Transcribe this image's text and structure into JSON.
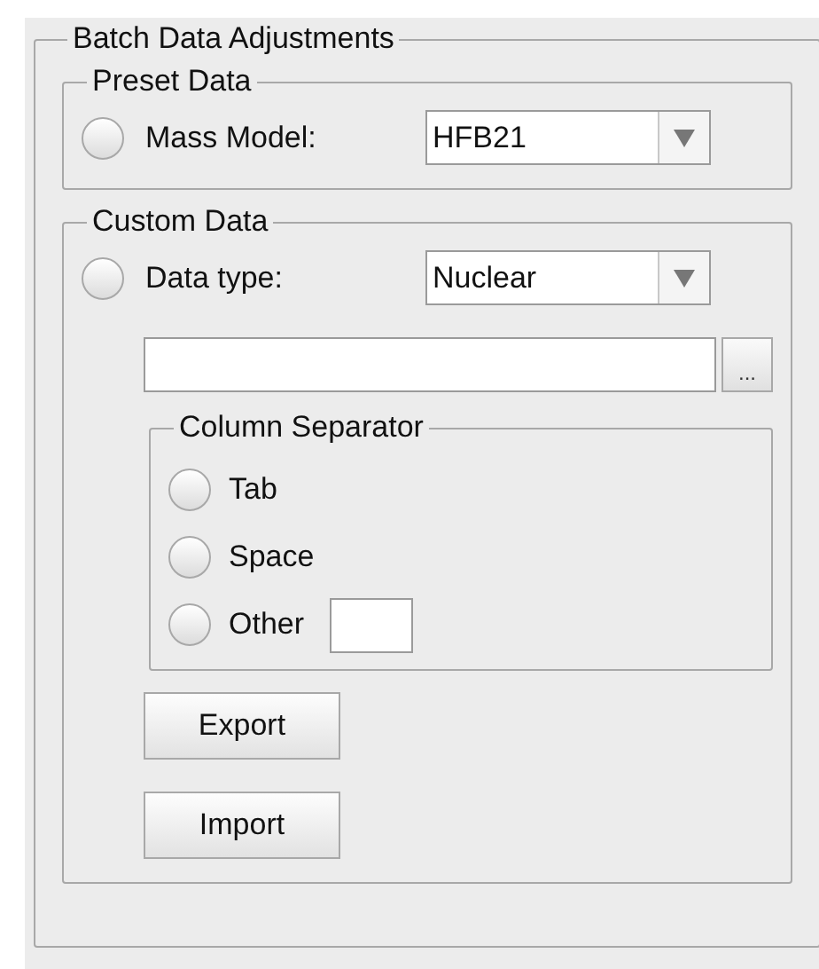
{
  "panel": {
    "title": "Batch Data Adjustments"
  },
  "preset": {
    "title": "Preset Data",
    "option": {
      "label": "Mass Model:",
      "selected": false
    },
    "combo": {
      "value": "HFB21"
    }
  },
  "custom": {
    "title": "Custom Data",
    "option": {
      "label": "Data type:",
      "selected": false
    },
    "combo": {
      "value": "Nuclear"
    },
    "browse_button": "...",
    "separator": {
      "title": "Column Separator",
      "options": [
        {
          "label": "Tab",
          "selected": false
        },
        {
          "label": "Space",
          "selected": false
        },
        {
          "label": "Other",
          "selected": false
        }
      ]
    },
    "buttons": [
      "Export",
      "Import"
    ]
  }
}
